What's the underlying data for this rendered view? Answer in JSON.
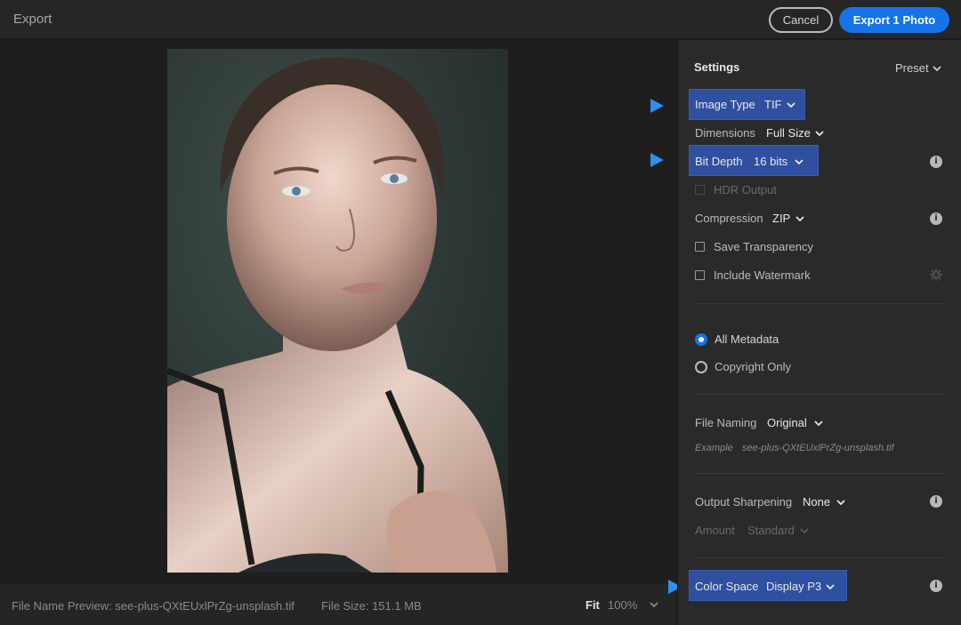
{
  "window": {
    "title": "Export",
    "cancel_label": "Cancel",
    "export_label": "Export 1 Photo"
  },
  "status": {
    "file_name_preview": "File Name Preview: see-plus-QXtEUxlPrZg-unsplash.tif",
    "file_size": "File Size: 151.1 MB",
    "fit_label": "Fit",
    "zoom_label": "100%"
  },
  "settings": {
    "header": "Settings",
    "preset_label": "Preset",
    "image_type": {
      "label": "Image Type",
      "value": "TIF"
    },
    "dimensions": {
      "label": "Dimensions",
      "value": "Full Size"
    },
    "bit_depth": {
      "label": "Bit Depth",
      "value": "16 bits"
    },
    "hdr_output": {
      "label": "HDR Output",
      "checked": false,
      "enabled": false
    },
    "compression": {
      "label": "Compression",
      "value": "ZIP"
    },
    "save_transparency": {
      "label": "Save Transparency",
      "checked": false
    },
    "include_watermark": {
      "label": "Include Watermark",
      "checked": false
    },
    "metadata": {
      "options": [
        "All Metadata",
        "Copyright Only"
      ],
      "selected": "All Metadata"
    },
    "file_naming": {
      "label": "File Naming",
      "value": "Original",
      "example_label": "Example",
      "example_value": "see-plus-QXtEUxlPrZg-unsplash.tif"
    },
    "output_sharpening": {
      "label": "Output Sharpening",
      "value": "None",
      "amount_label": "Amount",
      "amount_value": "Standard"
    },
    "color_space": {
      "label": "Color Space",
      "value": "Display P3"
    }
  },
  "colors": {
    "accent": "#1473e6",
    "highlight": "#2f4fa0",
    "pointer_arrow": "#2f8ef0",
    "panel_bg": "#2a2a2a",
    "app_bg": "#1e1e1e"
  },
  "icons": [
    "info-icon",
    "gear-icon",
    "chevron-down-icon",
    "pointer-arrow-icon"
  ]
}
